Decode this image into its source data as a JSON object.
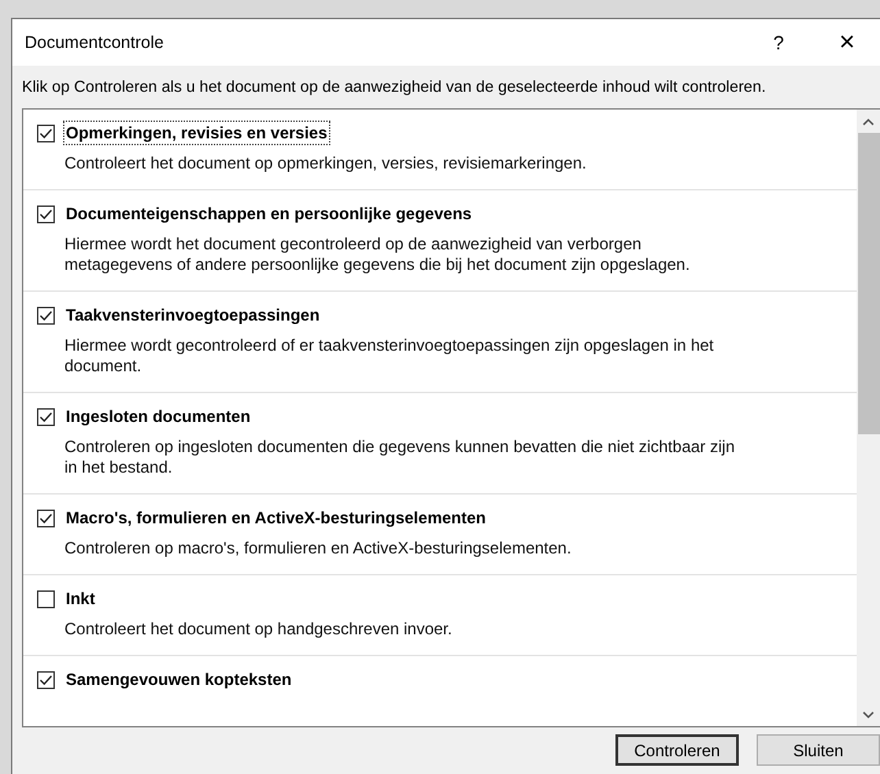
{
  "window": {
    "title": "Documentcontrole",
    "help": "?",
    "close": "×"
  },
  "instruction": "Klik op Controleren als u het document op de aanwezigheid van de geselecteerde inhoud wilt controleren.",
  "items": [
    {
      "label": "Opmerkingen, revisies en versies",
      "description": "Controleert het document op opmerkingen, versies, revisiemarkeringen.",
      "checked": true,
      "focused": true
    },
    {
      "label": "Documenteigenschappen en persoonlijke gegevens",
      "description": "Hiermee wordt het document gecontroleerd op de aanwezigheid van verborgen metagegevens of andere persoonlijke gegevens die bij het document zijn opgeslagen.",
      "checked": true,
      "focused": false
    },
    {
      "label": "Taakvensterinvoegtoepassingen",
      "description": "Hiermee wordt gecontroleerd of er taakvensterinvoegtoepassingen zijn opgeslagen in het document.",
      "checked": true,
      "focused": false
    },
    {
      "label": "Ingesloten documenten",
      "description": "Controleren op ingesloten documenten die gegevens kunnen bevatten die niet zichtbaar zijn in het bestand.",
      "checked": true,
      "focused": false
    },
    {
      "label": "Macro's, formulieren en ActiveX-besturingselementen",
      "description": "Controleren op macro's, formulieren en ActiveX-besturingselementen.",
      "checked": true,
      "focused": false
    },
    {
      "label": "Inkt",
      "description": "Controleert het document op handgeschreven invoer.",
      "checked": false,
      "focused": false
    },
    {
      "label": "Samengevouwen kopteksten",
      "checked": true,
      "focused": false
    }
  ],
  "buttons": [
    {
      "label": "Controleren",
      "default": true
    },
    {
      "label": "Sluiten",
      "default": false
    }
  ]
}
